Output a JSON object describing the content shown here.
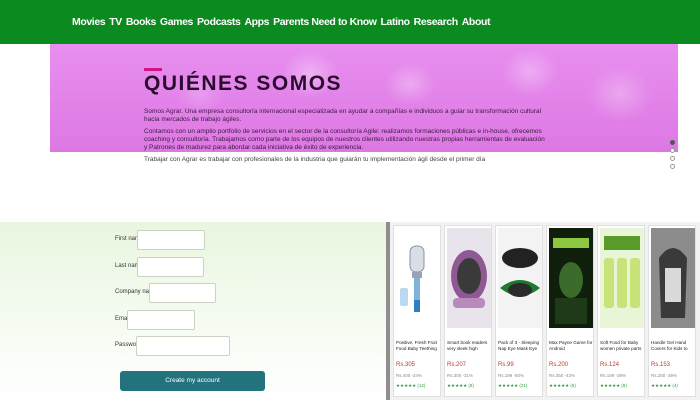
{
  "nav": {
    "items": [
      "Movies",
      "TV",
      "Books",
      "Games",
      "Podcasts",
      "Apps",
      "Parents Need to Know",
      "Latino",
      "Research",
      "About"
    ]
  },
  "hero": {
    "title": "QUIÉNES SOMOS",
    "p1": "Somos Agrar. Una empresa consultoría internacional especializada en ayudar a compañías e individuos a guiar su transformación cultural",
    "p1b": "hacia mercados de trabajo ágiles.",
    "p2": "Contamos con un amplio portfolio de servicios en el sector de la consultoría Agile: realizamos formaciones públicas e in-house, ofrecemos",
    "p2b": "coaching y consultoría. Trabajamos como parte de los equipos de nuestros clientes utilizando nuestras propias herramientas de evaluación",
    "p2c": "y Patrones de madurez para abordar cada iniciativa de éxito de experiencia.",
    "p3": "Trabajar con Agrar es trabajar con profesionales de la industria que guiarán tu implementación ágil desde el primer día"
  },
  "signup": {
    "first_name": "First name",
    "last_name": "Last name",
    "company": "Company name",
    "email": "Email",
    "password": "Password",
    "button": "Create my account"
  },
  "products": [
    {
      "title": "Positive, Fresh Fruit Food Baby Teething Safe Feed...",
      "price": "Rs.305",
      "old": "Rs.400 -24%",
      "rating": "★★★★★ (12)"
    },
    {
      "title": "Smart book readers very sleek high quality wa...",
      "price": "Rs.207",
      "old": "Rs.300 -31%",
      "rating": "★★★★★ (8)"
    },
    {
      "title": "Pack of 3 - Sleeping Nap Eye Mask Eye Shade Cov...",
      "price": "Rs.99",
      "old": "Rs.199 -50%",
      "rating": "★★★★★ (21)"
    },
    {
      "title": "Max Payne Game for Android Smartphones...",
      "price": "Rs.200",
      "old": "Rs.350 -43%",
      "rating": "★★★★★ (5)"
    },
    {
      "title": "Soft Food for Baby women private parts pack of 3",
      "price": "Rs.124",
      "old": "Rs.199 -38%",
      "rating": "★★★★★ (9)"
    },
    {
      "title": "Handle Gel Hand Covers for Kids to Wash Hands Wash...",
      "price": "Rs.153",
      "old": "Rs.250 -39%",
      "rating": "★★★★★ (4)"
    }
  ]
}
